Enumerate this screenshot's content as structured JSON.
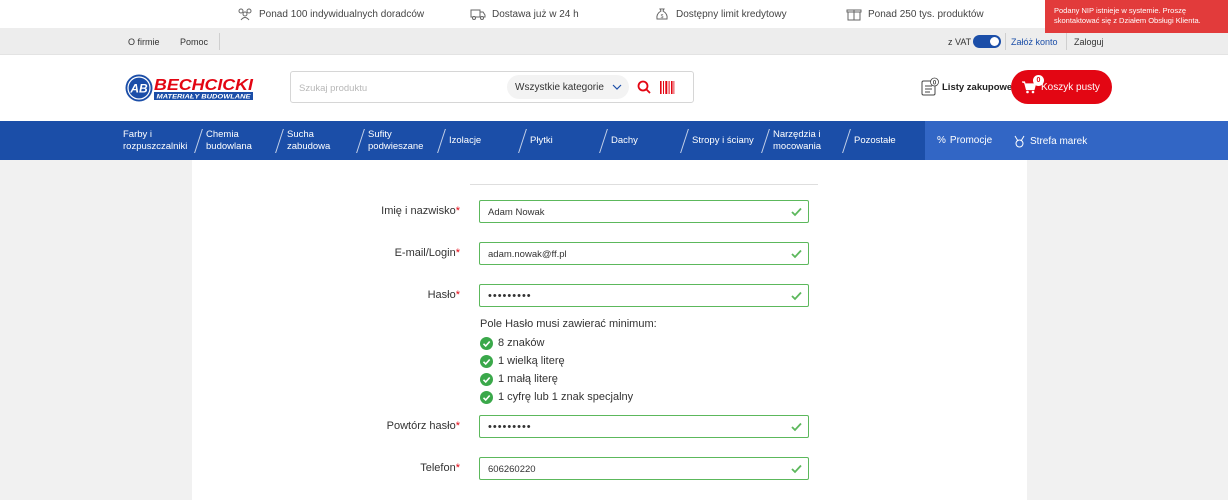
{
  "benefits": [
    {
      "icon": "advisors-icon",
      "label": "Ponad 100 indywidualnych doradców"
    },
    {
      "icon": "delivery-truck-icon",
      "label": "Dostawa już w 24 h"
    },
    {
      "icon": "money-bag-icon",
      "label": "Dostępny limit kredytowy"
    },
    {
      "icon": "box-icon",
      "label": "Ponad 250 tys. produktów"
    }
  ],
  "toast": {
    "message": "Podany NIP istnieje w systemie. Proszę skontaktować się z Działem Obsługi Klienta."
  },
  "utility": {
    "about": "O firmie",
    "help": "Pomoc",
    "vat_label": "z VAT",
    "register": "Załóż konto",
    "login": "Zaloguj"
  },
  "header": {
    "logo_name": "BECHCICKI",
    "logo_sub": "MATERIAŁY BUDOWLANE",
    "logo_mark": "AB",
    "search_placeholder": "Szukaj produktu",
    "category_select": "Wszystkie kategorie",
    "lists_label": "Listy zakupowe",
    "lists_count": "0",
    "cart_label": "Koszyk pusty",
    "cart_count": "0"
  },
  "nav": {
    "items": [
      {
        "line1": "Farby i",
        "line2": "rozpuszczalniki"
      },
      {
        "line1": "Chemia",
        "line2": "budowlana"
      },
      {
        "line1": "Sucha",
        "line2": "zabudowa"
      },
      {
        "line1": "Sufity",
        "line2": "podwieszane"
      },
      {
        "line1": "Izolacje",
        "line2": ""
      },
      {
        "line1": "Płytki",
        "line2": ""
      },
      {
        "line1": "Dachy",
        "line2": ""
      },
      {
        "line1": "Stropy i ściany",
        "line2": ""
      },
      {
        "line1": "Narzędzia i",
        "line2": "mocowania"
      },
      {
        "line1": "Pozostałe",
        "line2": ""
      }
    ],
    "promo": "Promocje",
    "promo_prefix": "%",
    "brands": "Strefa marek"
  },
  "form": {
    "fields": {
      "name": {
        "label": "Imię i nazwisko",
        "value": "Adam Nowak"
      },
      "email": {
        "label": "E-mail/Login",
        "value": "adam.nowak@ff.pl"
      },
      "password": {
        "label": "Hasło",
        "value": "123456789"
      },
      "password_repeat": {
        "label": "Powtórz hasło",
        "value": "123456789"
      },
      "phone": {
        "label": "Telefon",
        "value": "606260220"
      }
    },
    "required_mark": "*",
    "password_rules_title": "Pole Hasło musi zawierać minimum:",
    "password_rules": [
      "8 znaków",
      "1 wielką literę",
      "1 małą literę",
      "1 cyfrę lub 1 znak specjalny"
    ]
  },
  "colors": {
    "brand_blue": "#1b4ea8",
    "brand_red": "#e30613",
    "valid_green": "#5cb85c",
    "toast_red": "#e23b3b"
  }
}
